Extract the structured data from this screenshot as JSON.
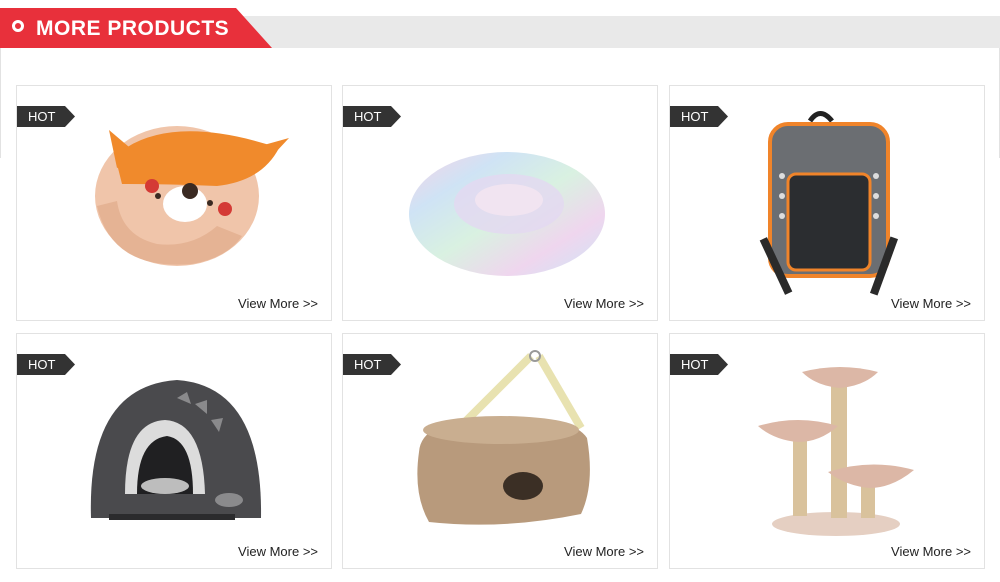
{
  "section": {
    "title": "MORE PRODUCTS",
    "accent_color": "#e8303b",
    "bar_color": "#e9e9e9"
  },
  "products": [
    {
      "badge": "HOT",
      "link": "View More >>",
      "image": "fox-cone-collar"
    },
    {
      "badge": "HOT",
      "link": "View More >>",
      "image": "rainbow-plush-donut-bed"
    },
    {
      "badge": "HOT",
      "link": "View More >>",
      "image": "pet-carrier-backpack"
    },
    {
      "badge": "HOT",
      "link": "View More >>",
      "image": "felt-dinosaur-cave-bed"
    },
    {
      "badge": "HOT",
      "link": "View More >>",
      "image": "fleece-hanging-bag-bed"
    },
    {
      "badge": "HOT",
      "link": "View More >>",
      "image": "cat-tree-scratcher"
    }
  ]
}
